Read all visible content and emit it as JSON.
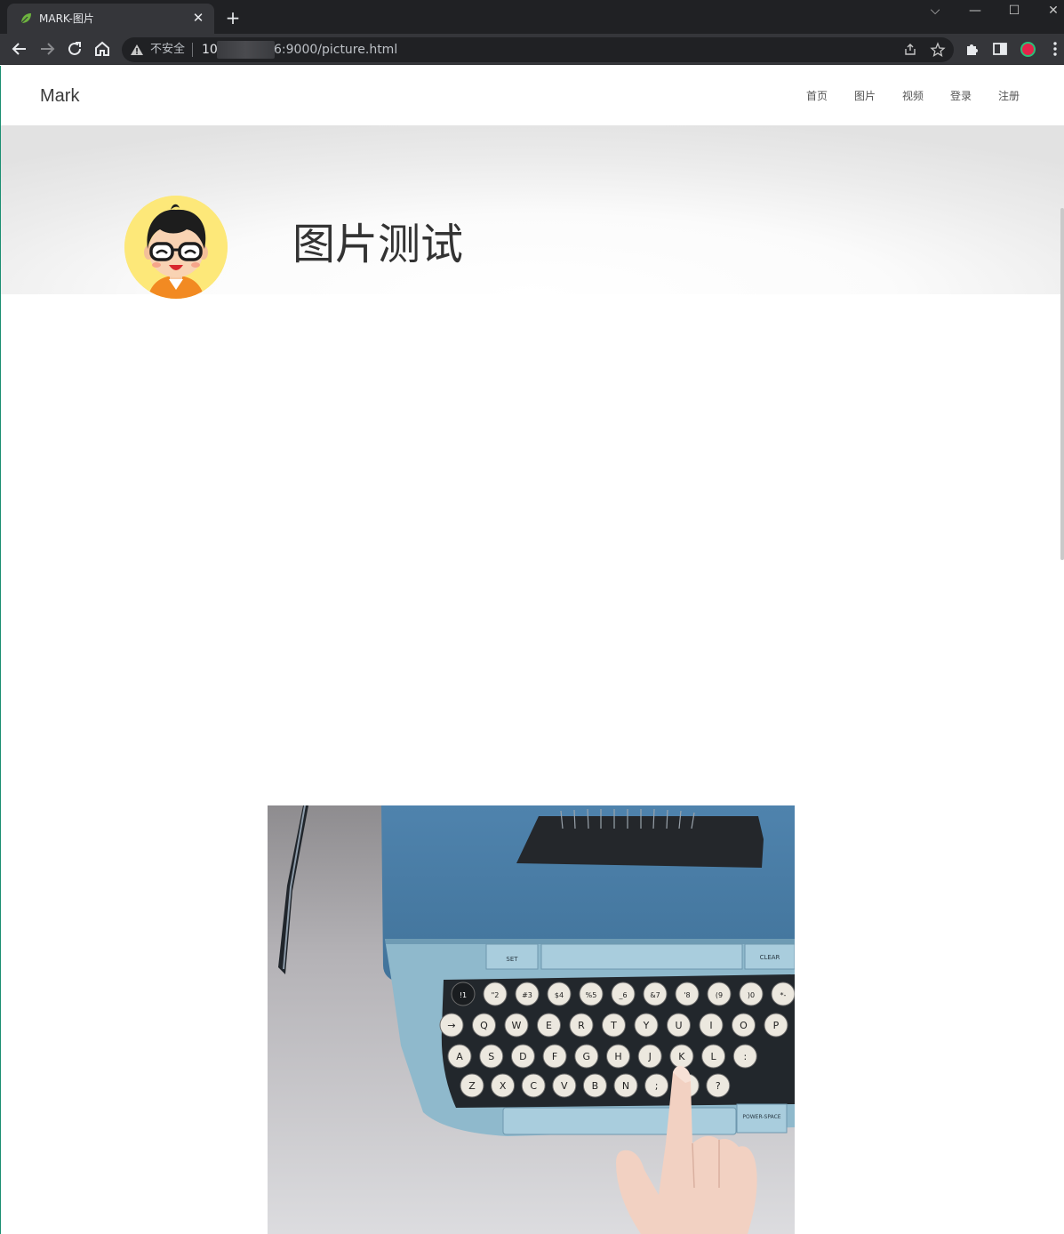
{
  "browser": {
    "tab_title": "MARK-图片",
    "tab_close": "✕",
    "new_tab": "+",
    "address": {
      "security_label": "不安全",
      "url_prefix": "10",
      "url_suffix": "6:9000/picture.html"
    },
    "window_controls": {
      "dropdown": "⌵",
      "minimize": "—",
      "maximize": "☐",
      "close": "✕"
    }
  },
  "site": {
    "brand": "Mark",
    "nav": [
      "首页",
      "图片",
      "视频",
      "登录",
      "注册"
    ]
  },
  "hero": {
    "title": "图片测试"
  },
  "photo": {
    "description_icon": "typewriter-photo",
    "keys": {
      "set": "SET",
      "clear": "CLEAR",
      "power_space": "POWER-SPACE",
      "row_numbers": [
        "!1",
        "\"2",
        "#3",
        "$4",
        "%5",
        "_6",
        "&7",
        "'8",
        "(9",
        ")0",
        "*-"
      ],
      "row_q": [
        "→",
        "Q",
        "W",
        "E",
        "R",
        "T",
        "Y",
        "U",
        "I",
        "O",
        "P"
      ],
      "row_a": [
        "A",
        "S",
        "D",
        "F",
        "G",
        "H",
        "J",
        "K",
        "L",
        ":"
      ],
      "row_z": [
        "Z",
        "X",
        "C",
        "V",
        "B",
        "N",
        ";",
        ":",
        "?"
      ]
    }
  },
  "colors": {
    "titlebar": "#202124",
    "toolbar": "#35363a",
    "typewriter_body": "#4d7fa6",
    "typewriter_keybed": "#8fb9cc",
    "avatar_bg": "#fde879"
  }
}
